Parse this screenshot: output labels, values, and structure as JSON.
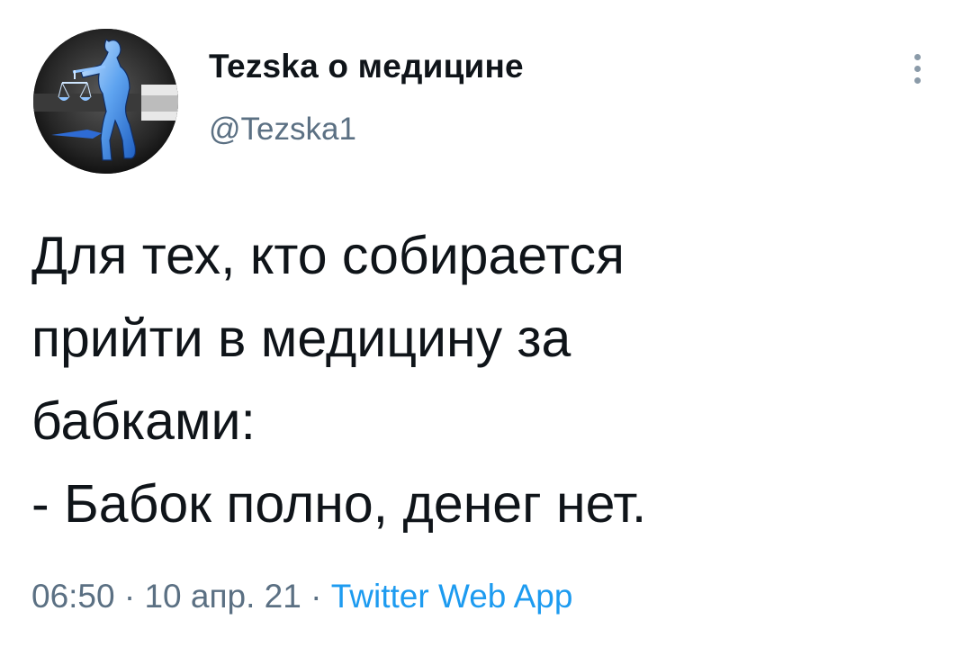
{
  "tweet": {
    "author": {
      "display_name": "Tezska о медицине",
      "handle": "@Tezska1",
      "avatar_icon": "scales-of-justice-figure-icon"
    },
    "text_lines": [
      "Для тех, кто собирается",
      "прийти в медицину за",
      "бабками:",
      "- Бабок полно, денег нет."
    ],
    "meta": {
      "time": "06:50",
      "separator": " · ",
      "date": "10 апр. 21",
      "source": "Twitter Web App"
    },
    "more_icon": "more-vertical-icon"
  },
  "colors": {
    "text": "#0f1419",
    "secondary": "#5b7083",
    "link": "#1d9bf0",
    "background": "#ffffff"
  }
}
